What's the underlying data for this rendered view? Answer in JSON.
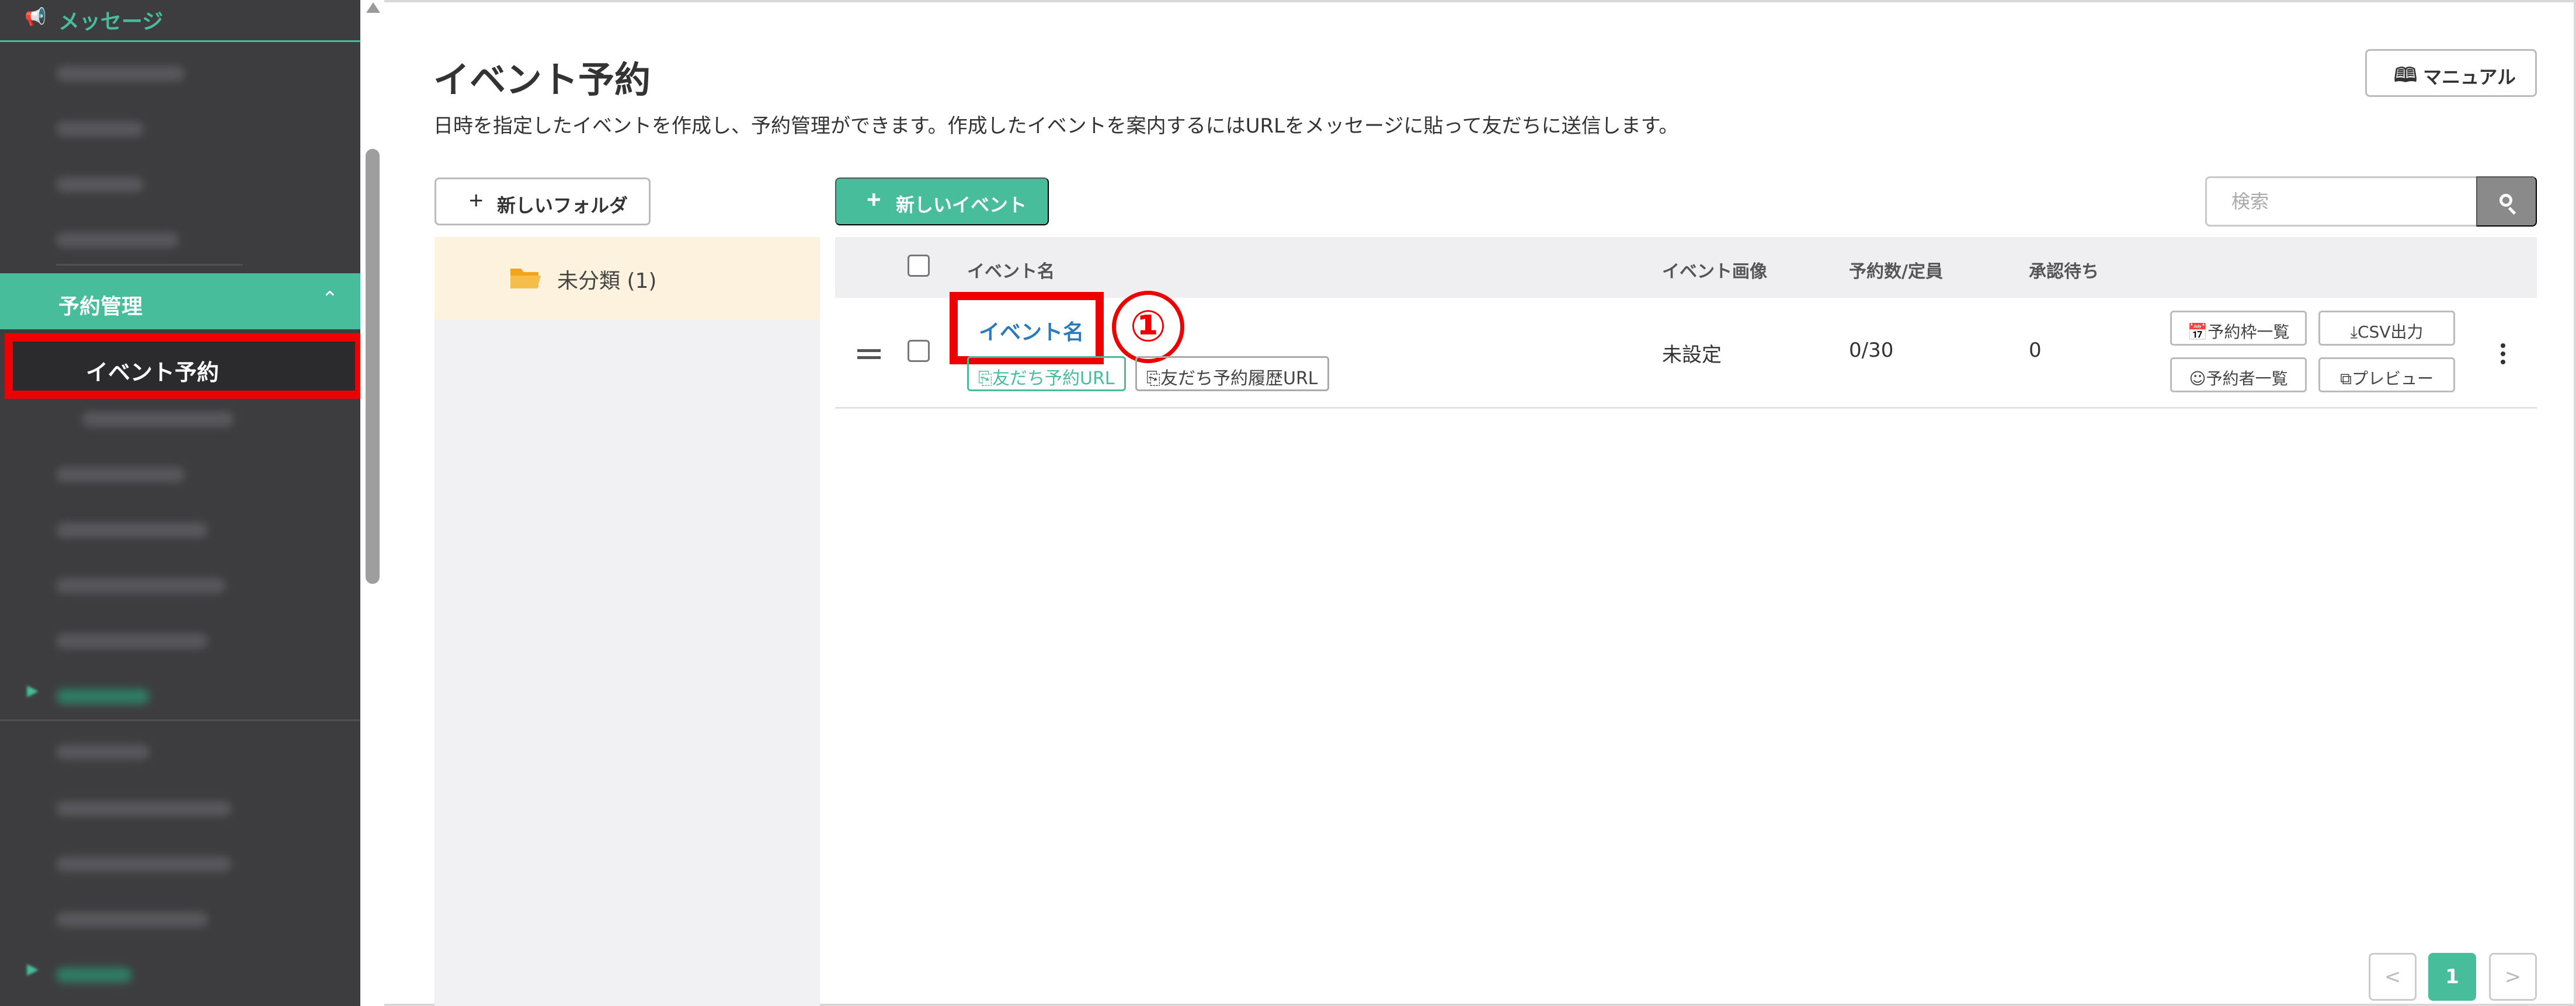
{
  "sidebar": {
    "top_label": "メッセージ",
    "active_section": "予約管理",
    "active_item": "イベント予約"
  },
  "main": {
    "title": "イベント予約",
    "description": "日時を指定したイベントを作成し、予約管理ができます。作成したイベントを案内するにはURLをメッセージに貼って友だちに送信します。",
    "manual_label": "マニュアル",
    "new_folder_label": "新しいフォルダ",
    "new_event_label": "新しいイベント",
    "search_placeholder": "検索"
  },
  "folders": [
    {
      "label": "未分類 (1)"
    }
  ],
  "table": {
    "columns": [
      "イベント名",
      "イベント画像",
      "予約数/定員",
      "承認待ち"
    ],
    "rows": [
      {
        "name": "イベント名",
        "friend_url_label": "友だち予約URL",
        "history_url_label": "友だち予約履歴URL",
        "image": "未設定",
        "reservations": "0/30",
        "pending": "0",
        "actions": {
          "slots": "予約枠一覧",
          "csv": "CSV出力",
          "reservers": "予約者一覧",
          "preview": "プレビュー"
        }
      }
    ]
  },
  "annotation": {
    "marker": "①",
    "color": "#ee0000"
  },
  "pagination": {
    "prev": "<",
    "current": "1",
    "next": ">"
  },
  "colors": {
    "accent": "#47bd9b",
    "sidebar_bg": "#3d3d3f",
    "link": "#2a7ac0",
    "folder_bg": "#fcf2dd"
  }
}
